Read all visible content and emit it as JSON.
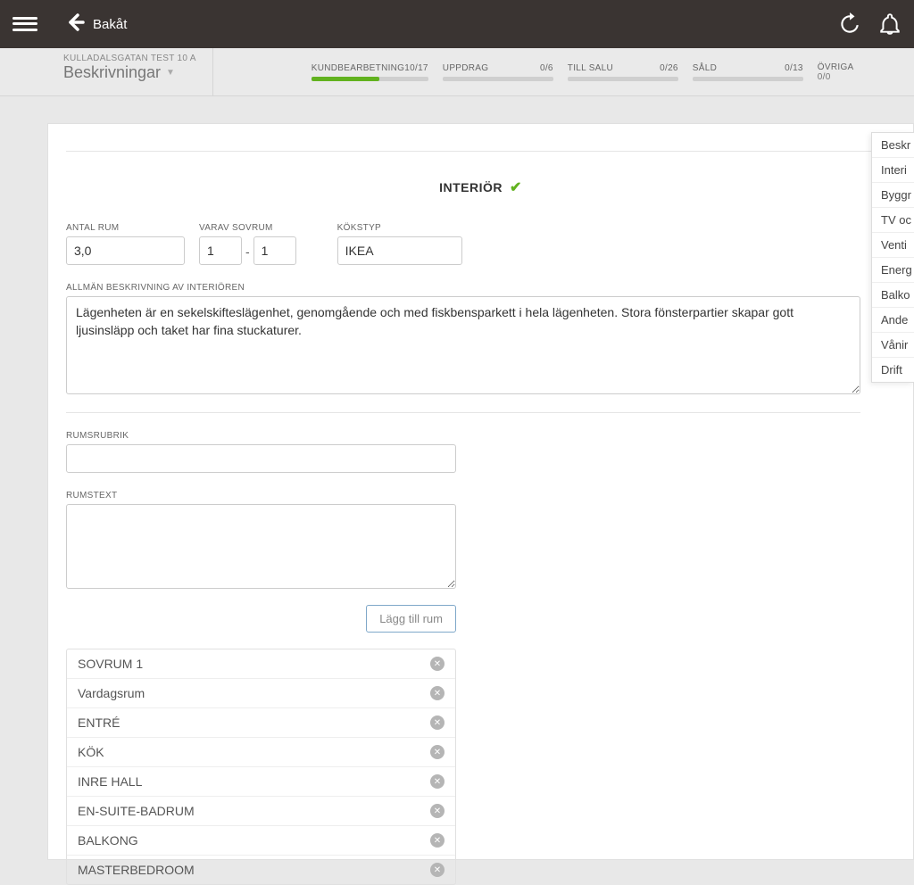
{
  "topbar": {
    "back_label": "Bakåt"
  },
  "subheader": {
    "address": "KULLADALSGATAN TEST 10 A",
    "title": "Beskrivningar"
  },
  "stats": [
    {
      "label": "KUNDBEARBETNING",
      "count": "10/17",
      "fill_pct": 58
    },
    {
      "label": "UPPDRAG",
      "count": "0/6",
      "fill_pct": 0
    },
    {
      "label": "TILL SALU",
      "count": "0/26",
      "fill_pct": 0
    },
    {
      "label": "SÅLD",
      "count": "0/13",
      "fill_pct": 0
    }
  ],
  "ovriga": {
    "label": "ÖVRIGA",
    "count": "0/0"
  },
  "section": {
    "title": "INTERIÖR"
  },
  "form": {
    "antal_rum_label": "ANTAL RUM",
    "antal_rum_value": "3,0",
    "varav_sovrum_label": "VARAV SOVRUM",
    "varav_sovrum_from": "1",
    "varav_sovrum_to": "1",
    "kokstyp_label": "KÖKSTYP",
    "kokstyp_value": "IKEA",
    "allman_label": "ALLMÄN BESKRIVNING AV INTERIÖREN",
    "allman_value": "Lägenheten är en sekelskifteslägenhet, genomgående och med fiskbensparkett i hela lägenheten. Stora fönsterpartier skapar gott ljusinsläpp och taket har fina stuckaturer.",
    "rumsrubrik_label": "RUMSRUBRIK",
    "rumsrubrik_value": "",
    "rumstext_label": "RUMSTEXT",
    "rumstext_value": "",
    "add_room_label": "Lägg till rum"
  },
  "rooms": [
    "SOVRUM 1",
    "Vardagsrum",
    "ENTRÉ",
    "KÖK",
    "INRE HALL",
    "EN-SUITE-BADRUM",
    "BALKONG",
    "MASTERBEDROOM"
  ],
  "side_menu": [
    "Beskr",
    "Interi",
    "Byggr",
    "TV oc",
    "Venti",
    "Energ",
    "Balko",
    "Ande",
    "Vånir",
    "Drift"
  ]
}
